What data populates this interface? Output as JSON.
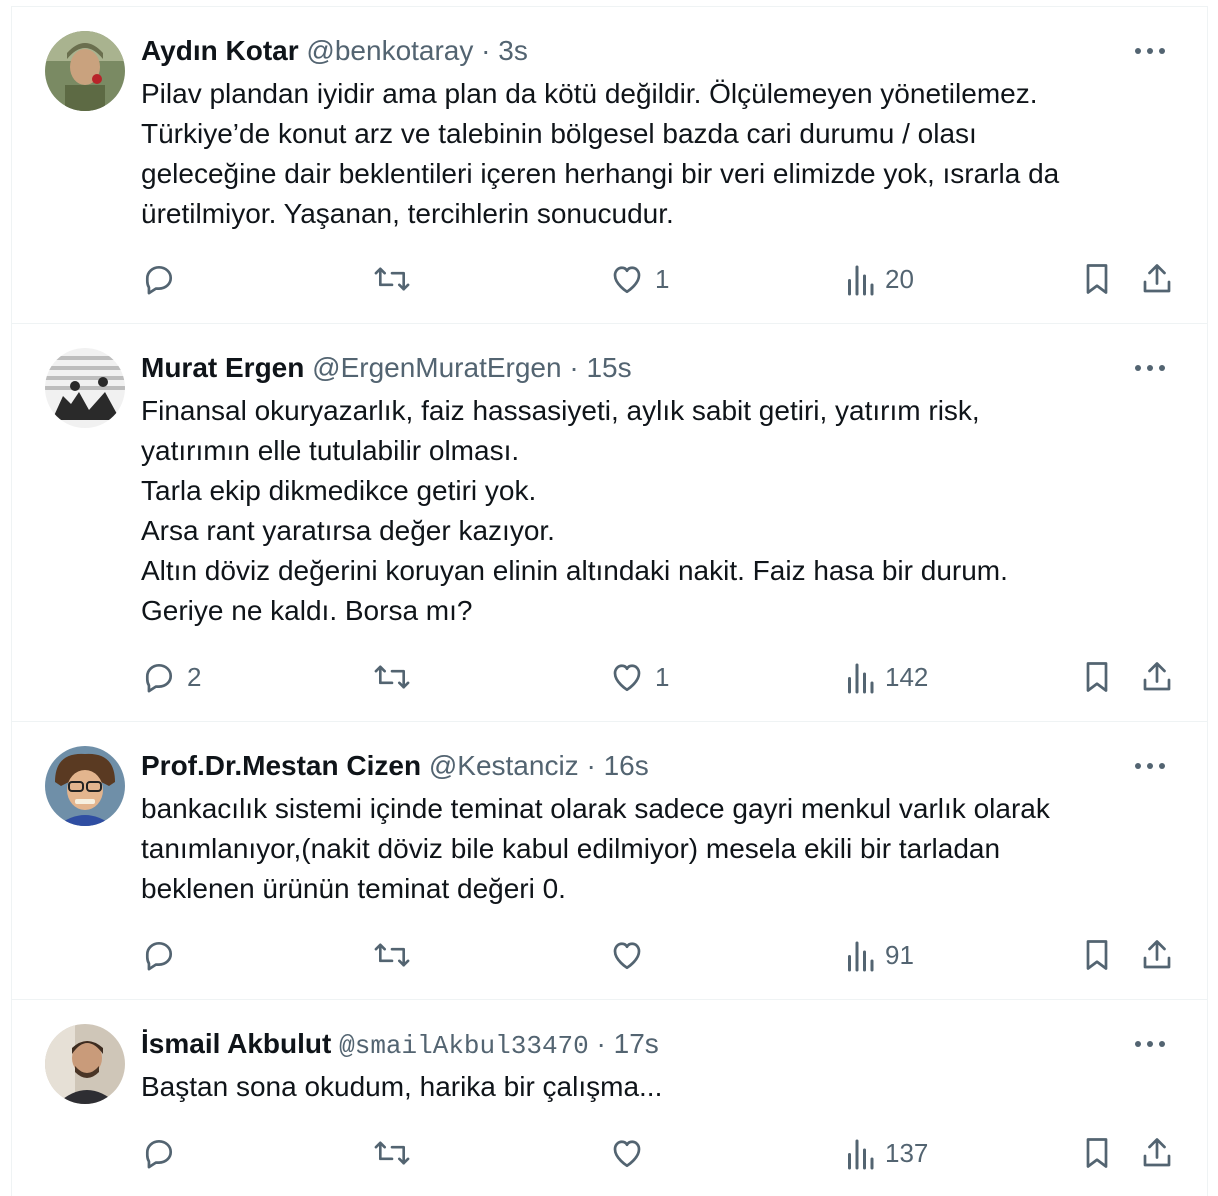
{
  "colors": {
    "text": "#0f1419",
    "secondary": "#536471",
    "divider": "#eff3f4"
  },
  "tweets": [
    {
      "name": "Aydın Kotar",
      "handle": "@benkotaray",
      "separator": "·",
      "time": "3s",
      "lines": [
        "Pilav plandan iyidir ama plan da kötü değildir. Ölçülemeyen yönetilemez.",
        "Türkiye’de konut arz ve talebinin bölgesel bazda cari durumu / olası",
        "geleceğine dair beklentileri içeren herhangi bir veri elimizde yok, ısrarla da",
        "üretilmiyor. Yaşanan, tercihlerin sonucudur."
      ],
      "replies": "",
      "retweets": "",
      "likes": "1",
      "views": "20"
    },
    {
      "name": "Murat Ergen",
      "handle": "@ErgenMuratErgen",
      "separator": "·",
      "time": "15s",
      "lines": [
        "Finansal okuryazarlık, faiz hassasiyeti, aylık sabit getiri, yatırım risk,",
        "yatırımın elle tutulabilir olması.",
        "Tarla ekip dikmedikce getiri yok.",
        "Arsa rant yaratırsa değer kazıyor.",
        "Altın döviz değerini koruyan elinin altındaki nakit. Faiz hasa bir durum.",
        "Geriye ne kaldı. Borsa mı?"
      ],
      "replies": "2",
      "retweets": "",
      "likes": "1",
      "views": "142"
    },
    {
      "name": "Prof.Dr.Mestan Cizen",
      "handle": "@Kestanciz",
      "separator": "·",
      "time": "16s",
      "lines": [
        "bankacılık sistemi içinde teminat olarak sadece gayri menkul varlık olarak",
        "tanımlanıyor,(nakit döviz bile kabul edilmiyor) mesela ekili bir tarladan",
        "beklenen ürünün teminat değeri 0."
      ],
      "replies": "",
      "retweets": "",
      "likes": "",
      "views": "91"
    },
    {
      "name": "İsmail Akbulut",
      "handle": "@smailAkbul33470",
      "separator": "·",
      "time": "17s",
      "lines": [
        "Baştan sona okudum, harika bir çalışma..."
      ],
      "replies": "",
      "retweets": "",
      "likes": "",
      "views": "137"
    }
  ]
}
